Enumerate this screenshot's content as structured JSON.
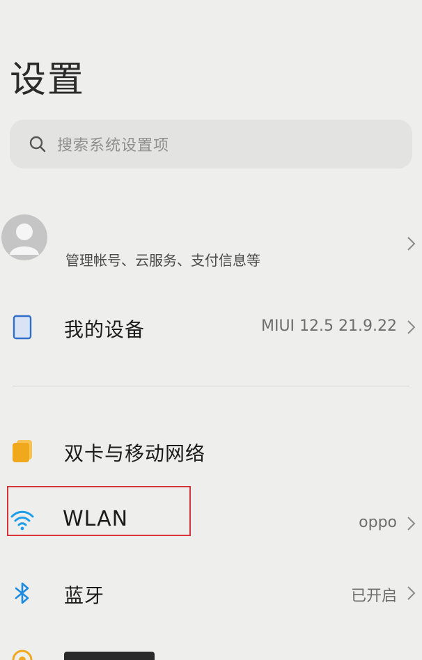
{
  "header": {
    "title": "设置"
  },
  "search": {
    "placeholder": "搜索系统设置项"
  },
  "account": {
    "subtitle": "管理帐号、云服务、支付信息等"
  },
  "rows": {
    "my_device": {
      "label": "我的设备",
      "value": "MIUI 12.5 21.9.22"
    },
    "sim": {
      "label": "双卡与移动网络"
    },
    "wlan": {
      "label": "WLAN",
      "value": "oppo"
    },
    "bluetooth": {
      "label": "蓝牙",
      "value": "已开启"
    }
  },
  "colors": {
    "background": "#eeeeec",
    "sim_icon": "#f0a81c",
    "wifi_icon": "#1e9eea",
    "bluetooth_icon": "#1d8be0",
    "device_icon": "#2f6fc9",
    "highlight_border": "#d6343a"
  },
  "icons": {
    "search": "search-icon",
    "avatar": "avatar-icon",
    "device": "phone-icon",
    "sim": "sim-card-icon",
    "wlan": "wifi-icon",
    "bluetooth": "bluetooth-icon",
    "chevron": "chevron-right-icon"
  }
}
